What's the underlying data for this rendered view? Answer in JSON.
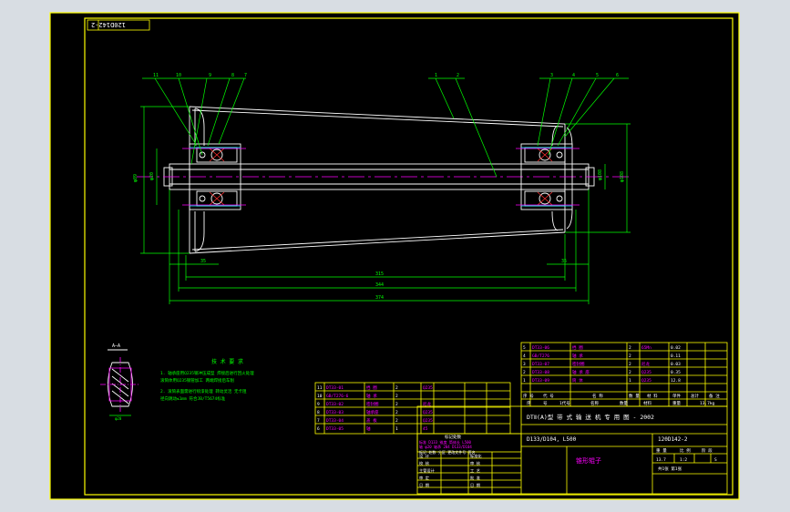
{
  "drawing": {
    "code_box": "120D142-2",
    "notes": {
      "title": "技 术 要 求",
      "lines": [
        "1. 轴承座用Q235钢冲压成型 焊接后进行回火处理",
        "  滚筒体用Q235钢管加工 两端焊接后车削",
        "2. 滚筒表面需进行喷漆处理 转动灵活 无卡阻",
        "  径向跳动≤1mm 符合JB/T5674标准"
      ]
    },
    "section_label": "A—A",
    "section_dim": "φ20",
    "dims": {
      "d1": "φ89",
      "d2": "φ108",
      "d3": "φ20",
      "d4": "φ108",
      "s1": "35",
      "s2": "35",
      "len1": "315",
      "len2": "344",
      "len3": "374"
    },
    "balloons": [
      "11",
      "10",
      "9",
      "8",
      "7",
      "1",
      "2",
      "3",
      "4",
      "5",
      "6"
    ]
  },
  "bom_left": {
    "rows": [
      [
        "11",
        "DT33-01",
        "挡 圈",
        "2",
        "Q235",
        "",
        ""
      ],
      [
        "10",
        "GB/T276-6",
        "轴 承",
        "2",
        "",
        "",
        ""
      ],
      [
        "9",
        "DT33-02",
        "密封圈",
        "2",
        "尼龙",
        "",
        ""
      ],
      [
        "8",
        "DT33-03",
        "轴承座",
        "2",
        "Q235",
        "",
        ""
      ],
      [
        "7",
        "DT33-04",
        "盖 板",
        "2",
        "Q235",
        "",
        ""
      ],
      [
        "6",
        "DT33-05",
        "轴",
        "1",
        "45",
        "",
        ""
      ]
    ]
  },
  "bom_right": {
    "rows": [
      [
        "5",
        "DT33-06",
        "挡 圈",
        "2",
        "65Mn",
        "0.02",
        ""
      ],
      [
        "4",
        "GB/T276",
        "轴 承",
        "2",
        "",
        "0.11",
        ""
      ],
      [
        "3",
        "DT33-07",
        "密封圈",
        "2",
        "尼龙",
        "0.03",
        ""
      ],
      [
        "2",
        "DT33-08",
        "轴 承 座",
        "2",
        "Q235",
        "0.35",
        ""
      ],
      [
        "1",
        "DT33-09",
        "筒 体",
        "1",
        "Q235",
        "12.8",
        ""
      ]
    ],
    "header": [
      "序 号",
      "代 号",
      "名 称",
      "数 量",
      "材 料",
      "单件",
      "总计",
      "备 注"
    ],
    "header2": [
      "序",
      "号",
      "1代号",
      "名称",
      "数量",
      "材料",
      "重量",
      "13.7kg"
    ]
  },
  "title_block": {
    "main_title": "DTⅡ(A)型  带 式 输 送 机 专 用 图 - 2002",
    "spec": "D133/D104, L500",
    "drawing_no": "120D142-2",
    "part_name": "锥形辊子",
    "scale_cells": [
      "重 量",
      "比 例",
      "阶 段"
    ],
    "scale_vals": [
      "13.7",
      "1:2",
      "S"
    ],
    "sheet": "共1张 第1张",
    "change_title": "标记处数",
    "change_lines": [
      "标准 D133 锥度 筒体长 L500",
      "轴 φ20 轴承 204 D133/D104",
      "标记 处数 分区 更改文件号 签名"
    ],
    "sign_rows": [
      [
        "设 计",
        "",
        "标准化",
        ""
      ],
      [
        "校 核",
        "",
        "审 核",
        ""
      ],
      [
        "主管设计",
        "",
        "工 艺",
        ""
      ],
      [
        "审 定",
        "",
        "批 准",
        ""
      ],
      [
        "日 期",
        "",
        "日 期",
        ""
      ]
    ]
  }
}
